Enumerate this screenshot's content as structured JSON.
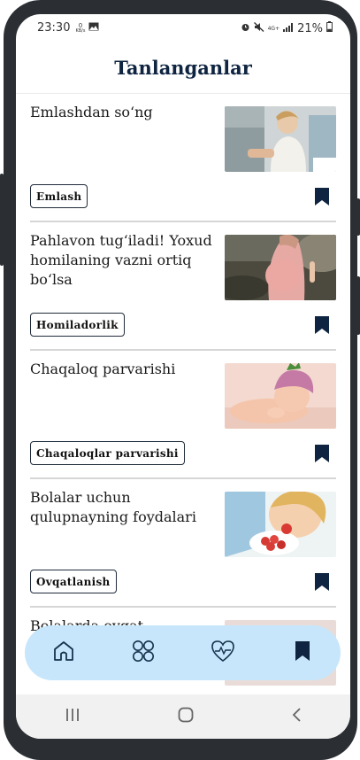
{
  "status": {
    "time": "23:30",
    "speed_value": "0",
    "speed_unit": "KB/s",
    "network": "4G+",
    "battery": "21%"
  },
  "header": {
    "title": "Tanlanganlar"
  },
  "articles": [
    {
      "title": "Emlashdan so‘ng",
      "tag": "Emlash",
      "thumb": "vaccination-photo"
    },
    {
      "title": "Pahlavon tug‘iladi! Yoxud homilaning vazni ortiq bo‘lsa",
      "tag": "Homiladorlik",
      "thumb": "pregnancy-photo"
    },
    {
      "title": "Chaqaloq parvarishi",
      "tag": "Chaqaloqlar parvarishi",
      "thumb": "baby-photo"
    },
    {
      "title": "Bolalar uchun qulupnayning foydalari",
      "tag": "Ovqatlanish",
      "thumb": "strawberry-photo"
    },
    {
      "title": "Bolalarda ovqat allergiyasi",
      "tag": "",
      "thumb": "allergy-photo"
    }
  ],
  "nav": {
    "items": [
      "home-icon",
      "categories-icon",
      "health-icon",
      "bookmark-icon"
    ],
    "active": "bookmark-icon"
  },
  "colors": {
    "title": "#0e2440",
    "nav_bg": "#c7e6fb",
    "bookmark": "#0e2440"
  }
}
